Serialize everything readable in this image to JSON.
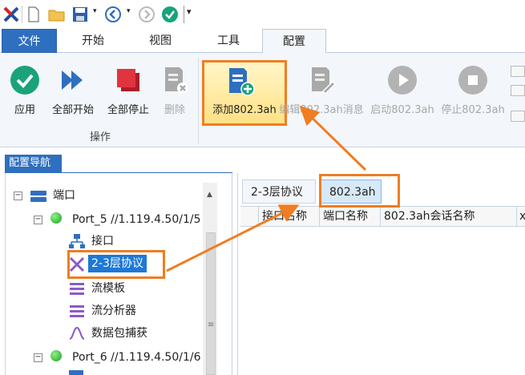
{
  "quick_access": {
    "icons": [
      "app-logo-icon",
      "new-icon",
      "open-folder-icon",
      "save-icon",
      "back-icon",
      "forward-icon",
      "check-icon",
      "customize-icon"
    ]
  },
  "tabs": [
    {
      "label": "文件"
    },
    {
      "label": "开始"
    },
    {
      "label": "视图"
    },
    {
      "label": "工具"
    },
    {
      "label": "配置"
    }
  ],
  "ribbon": {
    "buttons": [
      {
        "label": "应用",
        "icon": "apply-check-icon",
        "enabled": true
      },
      {
        "label": "全部开始",
        "icon": "start-all-icon",
        "enabled": true
      },
      {
        "label": "全部停止",
        "icon": "stop-all-icon",
        "enabled": true
      },
      {
        "label": "删除",
        "icon": "delete-doc-icon",
        "enabled": false
      },
      {
        "label": "添加802.3ah",
        "icon": "add-doc-icon",
        "enabled": true
      },
      {
        "label": "编辑802.3ah消息",
        "icon": "edit-doc-icon",
        "enabled": false
      },
      {
        "label": "启动802.3ah",
        "icon": "play-icon",
        "enabled": false
      },
      {
        "label": "停止802.3ah",
        "icon": "stop-icon",
        "enabled": false
      }
    ],
    "group_label": "操作"
  },
  "nav": {
    "title": "配置导航",
    "tree": [
      {
        "label": "端口",
        "icon": "port-root-icon"
      },
      {
        "label": "Port_5 //1.119.4.50/1/5",
        "icon": "status-green-icon"
      },
      {
        "label": "接口",
        "icon": "interface-icon"
      },
      {
        "label": "2-3层协议",
        "icon": "protocol-icon"
      },
      {
        "label": "流模板",
        "icon": "stream-template-icon"
      },
      {
        "label": "流分析器",
        "icon": "stream-analyzer-icon"
      },
      {
        "label": "数据包捕获",
        "icon": "capture-icon"
      },
      {
        "label": "Port_6 //1.119.4.50/1/6",
        "icon": "status-green-icon"
      }
    ]
  },
  "content": {
    "tabs": [
      {
        "label": "2-3层协议"
      },
      {
        "label": "802.3ah"
      }
    ],
    "columns": [
      "接口名称",
      "端口名称",
      "802.3ah会话名称",
      "x"
    ]
  },
  "colors": {
    "accent": "#2f6fbf",
    "highlight_orange": "#f07d22",
    "selection": "#1e78d7"
  }
}
